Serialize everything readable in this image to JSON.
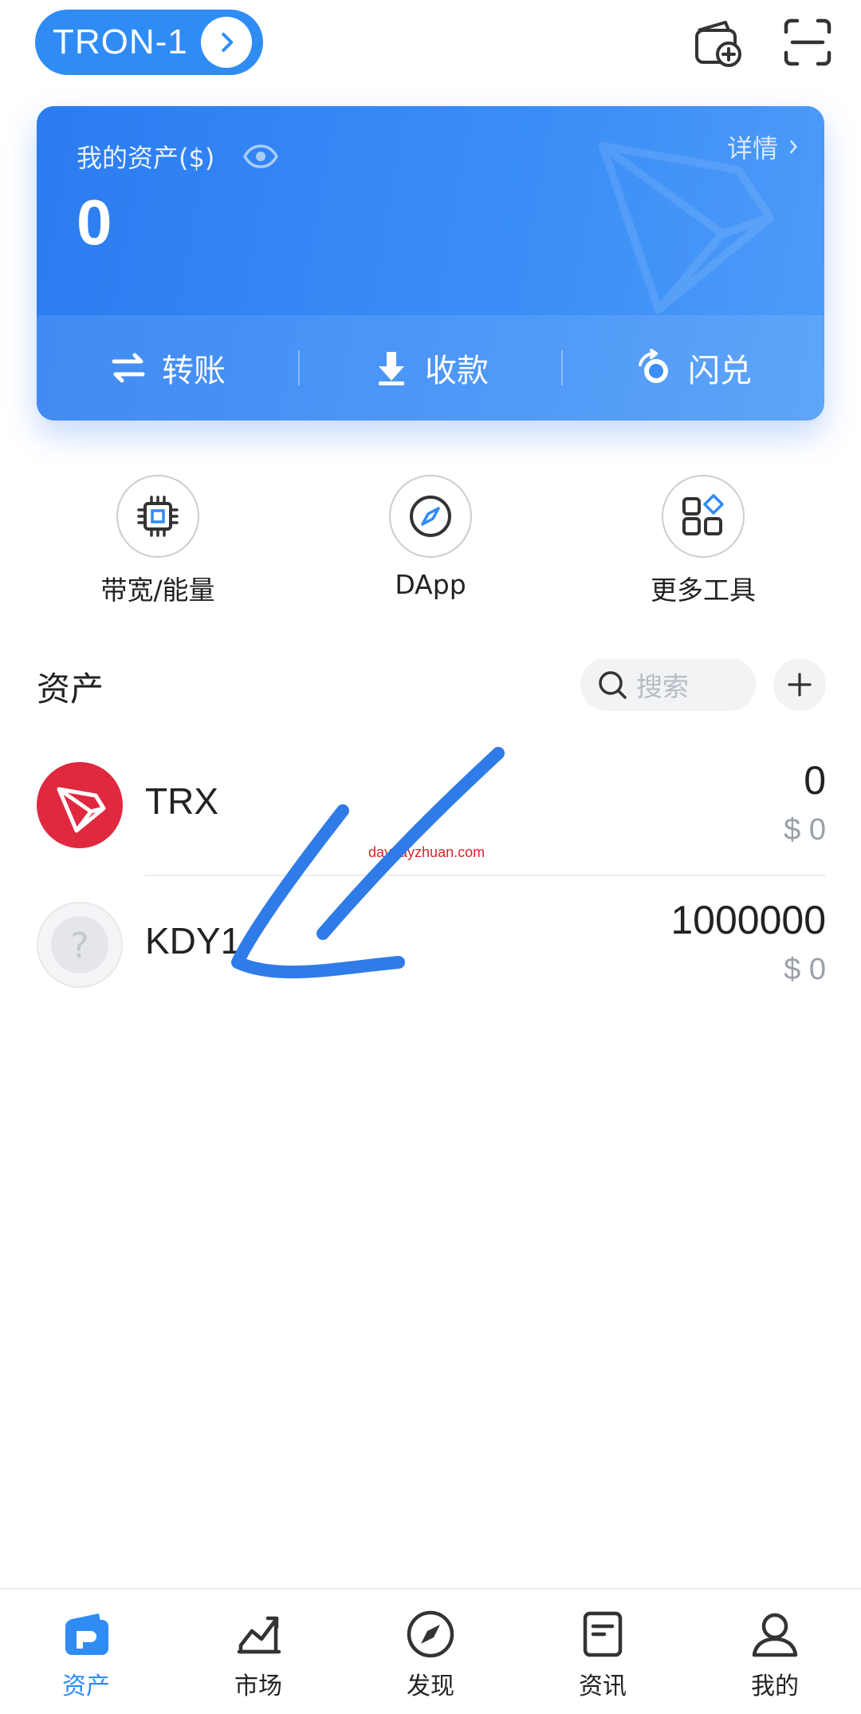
{
  "header": {
    "network": "TRON-1"
  },
  "card": {
    "title": "我的资产($)",
    "details": "详情",
    "balance": "0",
    "actions": [
      {
        "label": "转账",
        "icon": "transfer-icon"
      },
      {
        "label": "收款",
        "icon": "receive-icon"
      },
      {
        "label": "闪兑",
        "icon": "swap-icon"
      }
    ]
  },
  "tools": [
    {
      "label": "带宽/能量",
      "icon": "chip-icon"
    },
    {
      "label": "DApp",
      "icon": "compass-icon"
    },
    {
      "label": "更多工具",
      "icon": "grid-icon"
    }
  ],
  "assets": {
    "title": "资产",
    "search_placeholder": "搜索",
    "tokens": [
      {
        "name": "TRX",
        "amount": "0",
        "usd": "$ 0",
        "icon": "tron-logo-icon"
      },
      {
        "name": "KDY1",
        "amount": "1000000",
        "usd": "$ 0",
        "icon": "unknown-token-icon"
      }
    ]
  },
  "watermark_text": "daydayzhuan.com",
  "nav": [
    {
      "label": "资产",
      "icon": "wallet-icon",
      "active": true
    },
    {
      "label": "市场",
      "icon": "chart-icon"
    },
    {
      "label": "发现",
      "icon": "compass-icon"
    },
    {
      "label": "资讯",
      "icon": "news-icon"
    },
    {
      "label": "我的",
      "icon": "user-icon"
    }
  ],
  "colors": {
    "accent": "#2f8cf5",
    "tron_red": "#e0283f",
    "annotation_blue": "#2f7be8"
  }
}
